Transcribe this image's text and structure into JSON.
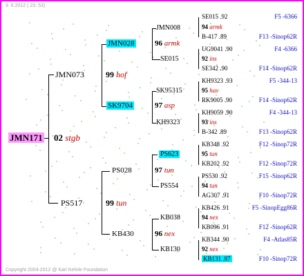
{
  "header": {
    "date": "9.  6.2012 ( 23: 53)"
  },
  "footer": {
    "copyright": "Copyright 2004-2012 @ Karl Kehrle Foundation"
  },
  "root": {
    "name": "JMN171",
    "year": "02",
    "breeder": "stgb"
  },
  "gen2": [
    {
      "name": "JMN073",
      "year": "99",
      "breeder": "hof"
    },
    {
      "name": "PS517",
      "year": "99",
      "breeder": "tun"
    }
  ],
  "gen3": [
    {
      "name": "JMN028",
      "year": "96",
      "breeder": "armk"
    },
    {
      "name": "SK9704",
      "year": "97",
      "breeder": "asp"
    },
    {
      "name": "PS028",
      "year": "97",
      "breeder": "tun"
    },
    {
      "name": "KB430",
      "year": "96",
      "breeder": "nex"
    }
  ],
  "gen4": [
    {
      "name": "JMN008",
      "year": "94",
      "breeder": "armk"
    },
    {
      "name": "SE015",
      "year": "92",
      "breeder": "ins"
    },
    {
      "name": "SK95315",
      "year": "95",
      "breeder": "has"
    },
    {
      "name": "KH9323",
      "year": "93",
      "breeder": "ins"
    },
    {
      "name": "PS623",
      "year": "95",
      "breeder": "tun"
    },
    {
      "name": "PS554",
      "year": "94",
      "breeder": "tun"
    },
    {
      "name": "KB038",
      "year": "94",
      "breeder": "nex"
    },
    {
      "name": "KB130",
      "year": "92",
      "breeder": "nex"
    }
  ],
  "gen5": [
    {
      "name": "SE015 .92",
      "ref": "F5 -6366"
    },
    {
      "name": "B-417 .89",
      "ref": "F13 -Sinop62R"
    },
    {
      "name": "UG9041 .90",
      "ref": "F4 -6366"
    },
    {
      "name": "SE342 .90",
      "ref": "F14 -Sinop62R"
    },
    {
      "name": "KH9323 .93",
      "ref": "F5 -344-13"
    },
    {
      "name": "RK9005 .90",
      "ref": "F14 -Sinop62R"
    },
    {
      "name": "KH9059 .90",
      "ref": "F4 -344-13"
    },
    {
      "name": "B-342 .89",
      "ref": "F13 -Sinop62R"
    },
    {
      "name": "KB348 .92",
      "ref": "F12 -Sinop72R"
    },
    {
      "name": "KB202 .92",
      "ref": "F12 -Sinop72R"
    },
    {
      "name": "PS530 .92",
      "ref": "F15 -Sinop62R"
    },
    {
      "name": "AG307 .91",
      "ref": "F10 -Sinop72R"
    },
    {
      "name": "KB426 .91",
      "ref": "F5 -SinopEgg86R"
    },
    {
      "name": "KB096 .91",
      "ref": "F12 -Sinop62R"
    },
    {
      "name": "KB344 .90",
      "ref": "F4 -Atlas85R"
    },
    {
      "name": "KB131 .87",
      "ref": "F10 -Sinop72R"
    }
  ]
}
